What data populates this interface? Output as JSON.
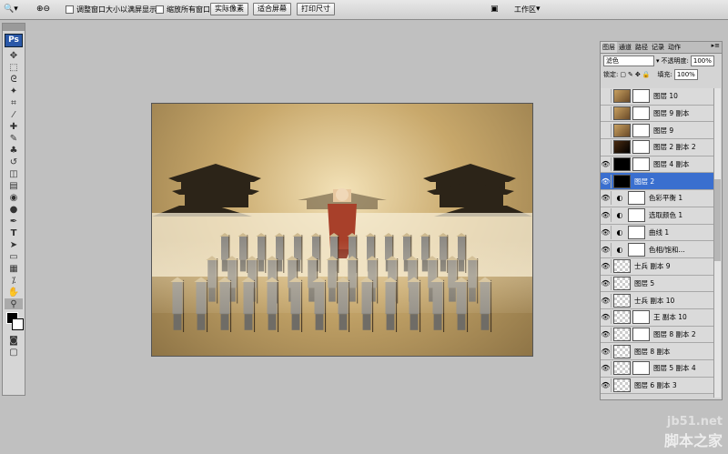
{
  "options_bar": {
    "resize_windows_label": "调整窗口大小以满屏显示",
    "zoom_all_label": "缩放所有窗口",
    "actual_pixels": "实际像素",
    "fit_screen": "适合屏幕",
    "print_size": "打印尺寸",
    "workspace": "工作区"
  },
  "toolbox": {
    "logo": "Ps"
  },
  "layers_panel": {
    "tabs": [
      "图层",
      "通道",
      "路径",
      "记录",
      "动作"
    ],
    "blend_mode": "滤色",
    "opacity_label": "不透明度:",
    "opacity_value": "100%",
    "lock_label": "锁定:",
    "fill_label": "填充:",
    "fill_value": "100%",
    "layers": [
      {
        "name": "图层 10",
        "visible": false,
        "kind": "photo",
        "mask": true,
        "selected": false
      },
      {
        "name": "图层 9 副本",
        "visible": false,
        "kind": "photo",
        "mask": true,
        "selected": false
      },
      {
        "name": "图层 9",
        "visible": false,
        "kind": "photo",
        "mask": true,
        "selected": false
      },
      {
        "name": "图层 2 副本 2",
        "visible": false,
        "kind": "dark",
        "mask": true,
        "selected": false
      },
      {
        "name": "图层 4 副本",
        "visible": true,
        "kind": "black",
        "mask": true,
        "selected": false
      },
      {
        "name": "图层 2",
        "visible": true,
        "kind": "black",
        "mask": false,
        "selected": true
      },
      {
        "name": "色彩平衡 1",
        "visible": true,
        "kind": "adjust",
        "mask": true,
        "selected": false
      },
      {
        "name": "选取颜色 1",
        "visible": true,
        "kind": "adjust",
        "mask": true,
        "selected": false
      },
      {
        "name": "曲线 1",
        "visible": true,
        "kind": "adjust",
        "mask": true,
        "selected": false
      },
      {
        "name": "色相/饱和...",
        "visible": true,
        "kind": "adjust",
        "mask": true,
        "selected": false
      },
      {
        "name": "士兵 副本 9",
        "visible": true,
        "kind": "trans",
        "mask": false,
        "selected": false
      },
      {
        "name": "图层 5",
        "visible": true,
        "kind": "trans",
        "mask": false,
        "selected": false
      },
      {
        "name": "士兵 副本 10",
        "visible": true,
        "kind": "trans",
        "mask": false,
        "selected": false
      },
      {
        "name": "王 副本 10",
        "visible": true,
        "kind": "trans",
        "mask": true,
        "selected": false
      },
      {
        "name": "图层 8 副本 2",
        "visible": true,
        "kind": "trans",
        "mask": true,
        "selected": false
      },
      {
        "name": "图层 8 副本",
        "visible": true,
        "kind": "trans",
        "mask": false,
        "selected": false
      },
      {
        "name": "图层 5 副本 4",
        "visible": true,
        "kind": "trans",
        "mask": true,
        "selected": false
      },
      {
        "name": "图层 6 副本 3",
        "visible": true,
        "kind": "trans",
        "mask": false,
        "selected": false
      }
    ]
  },
  "watermark": {
    "line1": "jb51.net",
    "line2": "脚本之家"
  },
  "colors": {
    "selection": "#3a6fcf",
    "panel_bg": "#d4d4d4",
    "workspace_bg": "#c0c0c0"
  }
}
